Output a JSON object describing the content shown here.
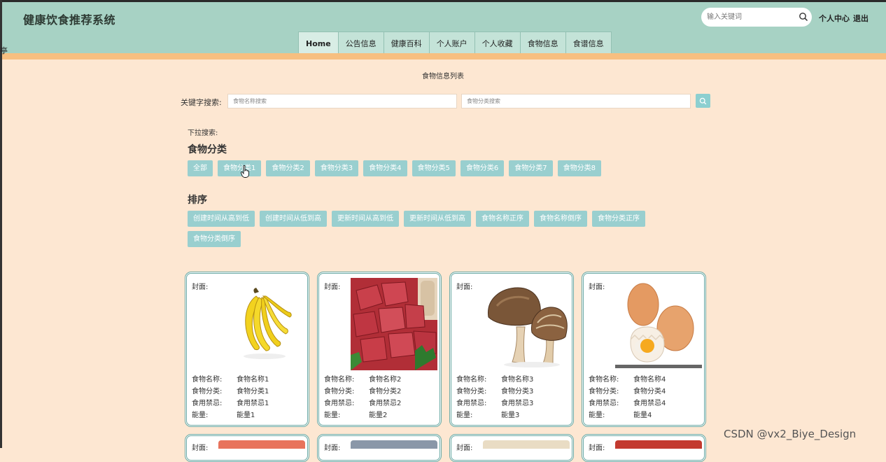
{
  "site": {
    "title": "健康饮食推荐系统",
    "side_char": "亭"
  },
  "header": {
    "search_placeholder": "输入关键词",
    "personal_center": "个人中心",
    "logout": "退出"
  },
  "nav": {
    "items": [
      {
        "label": "Home",
        "active": true
      },
      {
        "label": "公告信息"
      },
      {
        "label": "健康百科"
      },
      {
        "label": "个人账户"
      },
      {
        "label": "个人收藏"
      },
      {
        "label": "食物信息"
      },
      {
        "label": "食谱信息"
      }
    ]
  },
  "main": {
    "heading": "食物信息列表",
    "keyword_label": "关键字搜索:",
    "name_placeholder": "食物名称搜索",
    "category_placeholder": "食物分类搜索",
    "dropdown_label": "下拉搜索:",
    "category_title": "食物分类",
    "categories": [
      "全部",
      "食物分类1",
      "食物分类2",
      "食物分类3",
      "食物分类4",
      "食物分类5",
      "食物分类6",
      "食物分类7",
      "食物分类8"
    ],
    "sort_title": "排序",
    "sorts": [
      "创建时间从高到低",
      "创建时间从低到高",
      "更新时间从高到低",
      "更新时间从低到高",
      "食物名称正序",
      "食物名称倒序",
      "食物分类正序",
      "食物分类倒序"
    ]
  },
  "cards": [
    {
      "cover_label": "封面:",
      "image": "banana",
      "fields": [
        [
          "食物名称:",
          "食物名称1"
        ],
        [
          "食物分类:",
          "食物分类1"
        ],
        [
          "食用禁忌:",
          "食用禁忌1"
        ],
        [
          "能量:",
          "能量1"
        ]
      ]
    },
    {
      "cover_label": "封面:",
      "image": "beef",
      "fields": [
        [
          "食物名称:",
          "食物名称2"
        ],
        [
          "食物分类:",
          "食物分类2"
        ],
        [
          "食用禁忌:",
          "食用禁忌2"
        ],
        [
          "能量:",
          "能量2"
        ]
      ]
    },
    {
      "cover_label": "封面:",
      "image": "mushroom",
      "fields": [
        [
          "食物名称:",
          "食物名称3"
        ],
        [
          "食物分类:",
          "食物分类3"
        ],
        [
          "食用禁忌:",
          "食用禁忌3"
        ],
        [
          "能量:",
          "能量3"
        ]
      ]
    },
    {
      "cover_label": "封面:",
      "image": "eggs",
      "fields": [
        [
          "食物名称:",
          "食物名称4"
        ],
        [
          "食物分类:",
          "食物分类4"
        ],
        [
          "食用禁忌:",
          "食用禁忌4"
        ],
        [
          "能量:",
          "能量4"
        ]
      ]
    }
  ],
  "cards_row2": [
    {
      "cover_label": "封面:",
      "color": "#e8735c"
    },
    {
      "cover_label": "封面:",
      "color": "#8a97a8"
    },
    {
      "cover_label": "封面:",
      "color": "#e9dcc4"
    },
    {
      "cover_label": "封面:",
      "color": "#c33a2f"
    }
  ],
  "watermark": "CSDN @vx2_Biye_Design",
  "colors": {
    "header_bg": "#a7d2c4",
    "accent_bar": "#f7bf80",
    "page_bg": "#fde7d2",
    "button": "#99cfcf",
    "card_border": "#6aa9a4"
  }
}
